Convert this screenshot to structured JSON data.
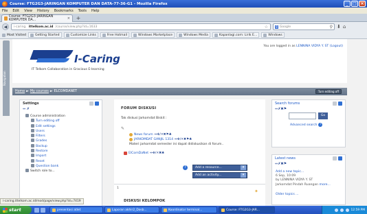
{
  "window": {
    "title": "Course: FTG2G3-JARINGAN KOMPUTER DAN DATA-77-36-G1 - Mozilla Firefox",
    "minimize": "_",
    "maximize": "□",
    "close": "×"
  },
  "menu": [
    "File",
    "Edit",
    "View",
    "History",
    "Bookmarks",
    "Tools",
    "Help"
  ],
  "tab": {
    "label": "Course: FTG2G3-JARINGAN KOMPUTER DA...",
    "close": "×",
    "new": "+"
  },
  "navbar": {
    "back": "◀",
    "url_prefix": "i-caring.",
    "url_domain": "ittelkom.ac.id",
    "url_path": "/course/view.php?id=1633",
    "star": "☆",
    "search_engine": "Google",
    "search_placeholder": "Google",
    "search_icon": "⚲"
  },
  "bookmarks": [
    "Most Visited",
    "Getting Started",
    "Customize Links",
    "Free Hotmail",
    "Windows Marketplace",
    "Windows Media",
    "Kapanlagi.com: Lirik E...",
    "Windows"
  ],
  "header": {
    "brand": "I-Caring",
    "tagline": "IT Telkom Collaboration in Gracious E-learning",
    "login_text": "You are logged in as",
    "login_user": "LENNINA VIDYA Y. ST",
    "logout": "(Logout)",
    "side_tab": "Navigation"
  },
  "breadcrumb": {
    "home": "Home",
    "sep1": "►",
    "courses": "My courses",
    "sep2": "►",
    "course": "ELCOMDANET",
    "edit_button": "Turn editing off"
  },
  "settings": {
    "title": "Settings",
    "icons": "⇔ ✗",
    "items": [
      {
        "label": "Course administration",
        "level": 1
      },
      {
        "label": "Turn editing off",
        "level": 2
      },
      {
        "label": "Edit settings",
        "level": 2
      },
      {
        "label": "Users",
        "level": 2
      },
      {
        "label": "Filters",
        "level": 2
      },
      {
        "label": "Grades",
        "level": 2
      },
      {
        "label": "Backup",
        "level": 2
      },
      {
        "label": "Restore",
        "level": 2
      },
      {
        "label": "Import",
        "level": 2
      },
      {
        "label": "Reset",
        "level": 2
      },
      {
        "label": "Question bank",
        "level": 2
      },
      {
        "label": "Switch role to...",
        "level": 1
      }
    ]
  },
  "main": {
    "section_title": "FORUM DISKUSI",
    "section_desc": "Tak diskusi Jarkomdat Biskit :",
    "activities": [
      {
        "label": "News forum",
        "edits": "⇔✥/✕✖⚑♣"
      },
      {
        "label": "JARKOMDAT GANJIL 1314",
        "edits": "⇔✥/✕✖⚑♣"
      },
      {
        "label": "Materi jarkomdat semester ini dapat didiskusikan di forum..",
        "edits": ""
      },
      {
        "label": "ElComDaNet",
        "edits": "⇔✥/✕✖♣"
      }
    ],
    "add_resource": "Add a resource...",
    "add_activity": "Add an activity...",
    "dropdown_arrow": "▾",
    "help": "?",
    "section_number": "1",
    "section2_title": "DISKUSI KELOMPOK"
  },
  "search_forums": {
    "title": "Search forums",
    "icons": "⇔✗✖⚑",
    "go": "Go",
    "advanced": "Advanced search",
    "help": "?"
  },
  "latest_news": {
    "title": "Latest news",
    "icons": "⇔✗✖⚑",
    "add_topic": "Add a new topic...",
    "date": "6 Sep, 10:09",
    "author": "by LENNINA VIDYA Y. ST",
    "headline": "Jarkomdat Pindah Ruangan",
    "more": "more...",
    "older": "Older topics ..."
  },
  "status": {
    "url": "i-caring.ittelkom.ac.id/mod/page/view.php?id=7419"
  },
  "taskbar": {
    "start": "start",
    "tasks": [
      "presentasi atlet",
      "Laporan akhir2_Dosb...",
      "Koordinator terminal...",
      "Course: FTG2G3-JAR..."
    ],
    "clock": "12:59 PM"
  }
}
